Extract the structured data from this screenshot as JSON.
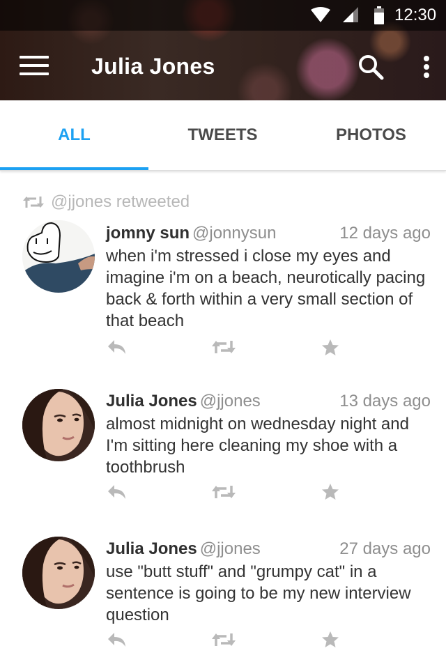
{
  "status_bar": {
    "time": "12:30",
    "icons": [
      "wifi-icon",
      "signal-icon",
      "battery-icon"
    ]
  },
  "toolbar": {
    "title": "Julia Jones",
    "icons": [
      "menu-icon",
      "search-icon",
      "more-vert-icon"
    ]
  },
  "tabs": [
    {
      "label": "ALL",
      "active": true
    },
    {
      "label": "TWEETS",
      "active": false
    },
    {
      "label": "PHOTOS",
      "active": false
    }
  ],
  "accent_color": "#1da1f2",
  "feed": {
    "retweet_notice": "@jjones retweeted",
    "tweets": [
      {
        "name": "jomny sun",
        "handle": "@jonnysun",
        "time": "12 days ago",
        "text": "when i'm stressed i close my eyes and imagine i'm on a beach, neurotically pacing back & forth within a very small section of that beach"
      },
      {
        "name": "Julia Jones",
        "handle": "@jjones",
        "time": "13 days ago",
        "text": "almost midnight on wednesday night and I'm sitting here cleaning my shoe with a toothbrush"
      },
      {
        "name": "Julia Jones",
        "handle": "@jjones",
        "time": "27 days ago",
        "text": "use \"butt stuff\" and \"grumpy cat\" in a sentence is going to be my new interview question"
      }
    ],
    "actions": [
      "reply-icon",
      "retweet-icon",
      "favorite-icon"
    ]
  }
}
